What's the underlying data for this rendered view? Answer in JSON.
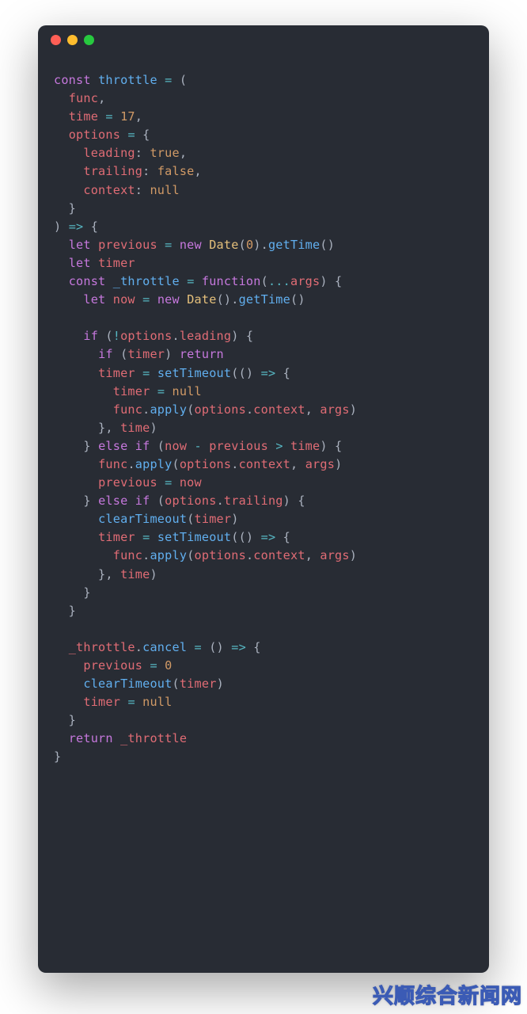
{
  "watermark": "兴顺综合新闻网",
  "code": {
    "tokens": [
      [
        [
          "kw",
          "const"
        ],
        [
          "",
          ", "
        ],
        [
          "fn",
          "throttle"
        ],
        [
          "",
          " "
        ],
        [
          "op",
          "="
        ],
        [
          "",
          " ("
        ]
      ],
      [
        [
          "",
          "  "
        ],
        [
          "var",
          "func"
        ],
        [
          "",
          ","
        ]
      ],
      [
        [
          "",
          "  "
        ],
        [
          "var",
          "time"
        ],
        [
          "",
          " "
        ],
        [
          "op",
          "="
        ],
        [
          "",
          " "
        ],
        [
          "num",
          "17"
        ],
        [
          "",
          ","
        ]
      ],
      [
        [
          "",
          "  "
        ],
        [
          "var",
          "options"
        ],
        [
          "",
          " "
        ],
        [
          "op",
          "="
        ],
        [
          "",
          " {"
        ]
      ],
      [
        [
          "",
          "    "
        ],
        [
          "var",
          "leading"
        ],
        [
          "",
          ": "
        ],
        [
          "bool",
          "true"
        ],
        [
          "",
          ","
        ]
      ],
      [
        [
          "",
          "    "
        ],
        [
          "var",
          "trailing"
        ],
        [
          "",
          ": "
        ],
        [
          "bool",
          "false"
        ],
        [
          "",
          ","
        ]
      ],
      [
        [
          "",
          "    "
        ],
        [
          "var",
          "context"
        ],
        [
          "",
          ": "
        ],
        [
          "bool",
          "null"
        ]
      ],
      [
        [
          "",
          "  }"
        ]
      ],
      [
        [
          "",
          ") "
        ],
        [
          "op",
          "=>"
        ],
        [
          "",
          " {"
        ]
      ],
      [
        [
          "",
          "  "
        ],
        [
          "kw",
          "let"
        ],
        [
          "",
          " "
        ],
        [
          "var",
          "previous"
        ],
        [
          "",
          " "
        ],
        [
          "op",
          "="
        ],
        [
          "",
          " "
        ],
        [
          "kw",
          "new"
        ],
        [
          "",
          " "
        ],
        [
          "cls",
          "Date"
        ],
        [
          "",
          "("
        ],
        [
          "num",
          "0"
        ],
        [
          "",
          ")."
        ],
        [
          "fn",
          "getTime"
        ],
        [
          "",
          "()"
        ]
      ],
      [
        [
          "",
          "  "
        ],
        [
          "kw",
          "let"
        ],
        [
          "",
          " "
        ],
        [
          "var",
          "timer"
        ]
      ],
      [
        [
          "",
          "  "
        ],
        [
          "kw",
          "const"
        ],
        [
          "",
          " "
        ],
        [
          "fn",
          "_throttle"
        ],
        [
          "",
          " "
        ],
        [
          "op",
          "="
        ],
        [
          "",
          " "
        ],
        [
          "kw",
          "function"
        ],
        [
          "",
          "("
        ],
        [
          "op",
          "..."
        ],
        [
          "var",
          "args"
        ],
        [
          "",
          ") {"
        ]
      ],
      [
        [
          "",
          "    "
        ],
        [
          "kw",
          "let"
        ],
        [
          "",
          " "
        ],
        [
          "var",
          "now"
        ],
        [
          "",
          " "
        ],
        [
          "op",
          "="
        ],
        [
          "",
          " "
        ],
        [
          "kw",
          "new"
        ],
        [
          "",
          " "
        ],
        [
          "cls",
          "Date"
        ],
        [
          "",
          "()."
        ],
        [
          "fn",
          "getTime"
        ],
        [
          "",
          "()"
        ]
      ],
      [
        [
          "",
          ""
        ]
      ],
      [
        [
          "",
          "    "
        ],
        [
          "kw",
          "if"
        ],
        [
          "",
          " ("
        ],
        [
          "op",
          "!"
        ],
        [
          "var",
          "options"
        ],
        [
          "",
          "."
        ],
        [
          "prop",
          "leading"
        ],
        [
          "",
          ") {"
        ]
      ],
      [
        [
          "",
          "      "
        ],
        [
          "kw",
          "if"
        ],
        [
          "",
          " ("
        ],
        [
          "var",
          "timer"
        ],
        [
          "",
          ") "
        ],
        [
          "kw",
          "return"
        ]
      ],
      [
        [
          "",
          "      "
        ],
        [
          "var",
          "timer"
        ],
        [
          "",
          " "
        ],
        [
          "op",
          "="
        ],
        [
          "",
          " "
        ],
        [
          "fn",
          "setTimeout"
        ],
        [
          "",
          "(() "
        ],
        [
          "op",
          "=>"
        ],
        [
          "",
          " {"
        ]
      ],
      [
        [
          "",
          "        "
        ],
        [
          "var",
          "timer"
        ],
        [
          "",
          " "
        ],
        [
          "op",
          "="
        ],
        [
          "",
          " "
        ],
        [
          "bool",
          "null"
        ]
      ],
      [
        [
          "",
          "        "
        ],
        [
          "var",
          "func"
        ],
        [
          "",
          "."
        ],
        [
          "fn",
          "apply"
        ],
        [
          "",
          "("
        ],
        [
          "var",
          "options"
        ],
        [
          "",
          "."
        ],
        [
          "prop",
          "context"
        ],
        [
          "",
          ", "
        ],
        [
          "var",
          "args"
        ],
        [
          "",
          ")"
        ]
      ],
      [
        [
          "",
          "      }, "
        ],
        [
          "var",
          "time"
        ],
        [
          "",
          ")"
        ]
      ],
      [
        [
          "",
          "    } "
        ],
        [
          "kw",
          "else"
        ],
        [
          "",
          " "
        ],
        [
          "kw",
          "if"
        ],
        [
          "",
          " ("
        ],
        [
          "var",
          "now"
        ],
        [
          "",
          " "
        ],
        [
          "op",
          "-"
        ],
        [
          "",
          " "
        ],
        [
          "var",
          "previous"
        ],
        [
          "",
          " "
        ],
        [
          "op",
          ">"
        ],
        [
          "",
          " "
        ],
        [
          "var",
          "time"
        ],
        [
          "",
          ") {"
        ]
      ],
      [
        [
          "",
          "      "
        ],
        [
          "var",
          "func"
        ],
        [
          "",
          "."
        ],
        [
          "fn",
          "apply"
        ],
        [
          "",
          "("
        ],
        [
          "var",
          "options"
        ],
        [
          "",
          "."
        ],
        [
          "prop",
          "context"
        ],
        [
          "",
          ", "
        ],
        [
          "var",
          "args"
        ],
        [
          "",
          ")"
        ]
      ],
      [
        [
          "",
          "      "
        ],
        [
          "var",
          "previous"
        ],
        [
          "",
          " "
        ],
        [
          "op",
          "="
        ],
        [
          "",
          " "
        ],
        [
          "var",
          "now"
        ]
      ],
      [
        [
          "",
          "    } "
        ],
        [
          "kw",
          "else"
        ],
        [
          "",
          " "
        ],
        [
          "kw",
          "if"
        ],
        [
          "",
          " ("
        ],
        [
          "var",
          "options"
        ],
        [
          "",
          "."
        ],
        [
          "prop",
          "trailing"
        ],
        [
          "",
          ") {"
        ]
      ],
      [
        [
          "",
          "      "
        ],
        [
          "fn",
          "clearTimeout"
        ],
        [
          "",
          "("
        ],
        [
          "var",
          "timer"
        ],
        [
          "",
          ")"
        ]
      ],
      [
        [
          "",
          "      "
        ],
        [
          "var",
          "timer"
        ],
        [
          "",
          " "
        ],
        [
          "op",
          "="
        ],
        [
          "",
          " "
        ],
        [
          "fn",
          "setTimeout"
        ],
        [
          "",
          "(() "
        ],
        [
          "op",
          "=>"
        ],
        [
          "",
          " {"
        ]
      ],
      [
        [
          "",
          "        "
        ],
        [
          "var",
          "func"
        ],
        [
          "",
          "."
        ],
        [
          "fn",
          "apply"
        ],
        [
          "",
          "("
        ],
        [
          "var",
          "options"
        ],
        [
          "",
          "."
        ],
        [
          "prop",
          "context"
        ],
        [
          "",
          ", "
        ],
        [
          "var",
          "args"
        ],
        [
          "",
          ")"
        ]
      ],
      [
        [
          "",
          "      }, "
        ],
        [
          "var",
          "time"
        ],
        [
          "",
          ")"
        ]
      ],
      [
        [
          "",
          "    }"
        ]
      ],
      [
        [
          "",
          "  }"
        ]
      ],
      [
        [
          "",
          ""
        ]
      ],
      [
        [
          "",
          "  "
        ],
        [
          "var",
          "_throttle"
        ],
        [
          "",
          "."
        ],
        [
          "fn",
          "cancel"
        ],
        [
          "",
          " "
        ],
        [
          "op",
          "="
        ],
        [
          "",
          " () "
        ],
        [
          "op",
          "=>"
        ],
        [
          "",
          " {"
        ]
      ],
      [
        [
          "",
          "    "
        ],
        [
          "var",
          "previous"
        ],
        [
          "",
          " "
        ],
        [
          "op",
          "="
        ],
        [
          "",
          " "
        ],
        [
          "num",
          "0"
        ]
      ],
      [
        [
          "",
          "    "
        ],
        [
          "fn",
          "clearTimeout"
        ],
        [
          "",
          "("
        ],
        [
          "var",
          "timer"
        ],
        [
          "",
          ")"
        ]
      ],
      [
        [
          "",
          "    "
        ],
        [
          "var",
          "timer"
        ],
        [
          "",
          " "
        ],
        [
          "op",
          "="
        ],
        [
          "",
          " "
        ],
        [
          "bool",
          "null"
        ]
      ],
      [
        [
          "",
          "  }"
        ]
      ],
      [
        [
          "",
          "  "
        ],
        [
          "kw",
          "return"
        ],
        [
          "",
          " "
        ],
        [
          "var",
          "_throttle"
        ]
      ],
      [
        [
          "",
          "}"
        ]
      ]
    ]
  }
}
